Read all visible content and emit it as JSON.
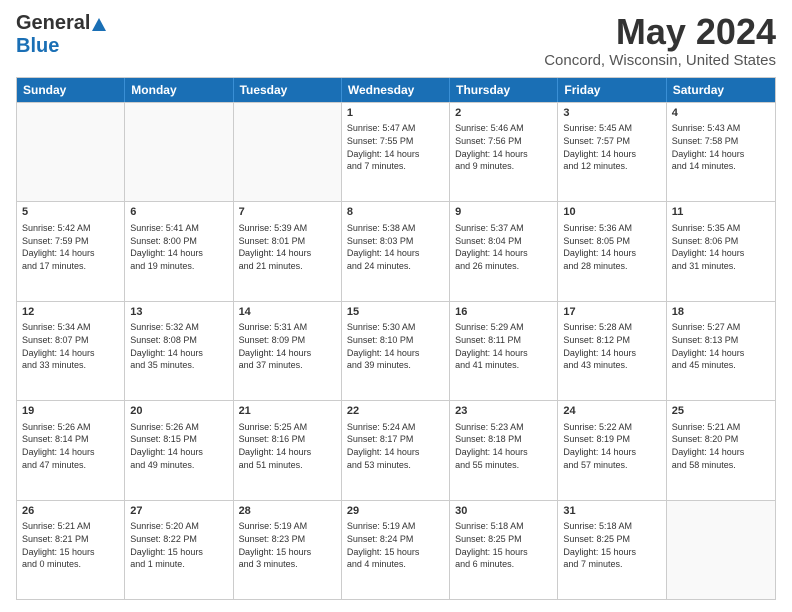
{
  "header": {
    "logo_general": "General",
    "logo_blue": "Blue",
    "month_title": "May 2024",
    "location": "Concord, Wisconsin, United States"
  },
  "days_of_week": [
    "Sunday",
    "Monday",
    "Tuesday",
    "Wednesday",
    "Thursday",
    "Friday",
    "Saturday"
  ],
  "weeks": [
    [
      {
        "day": "",
        "info": ""
      },
      {
        "day": "",
        "info": ""
      },
      {
        "day": "",
        "info": ""
      },
      {
        "day": "1",
        "info": "Sunrise: 5:47 AM\nSunset: 7:55 PM\nDaylight: 14 hours\nand 7 minutes."
      },
      {
        "day": "2",
        "info": "Sunrise: 5:46 AM\nSunset: 7:56 PM\nDaylight: 14 hours\nand 9 minutes."
      },
      {
        "day": "3",
        "info": "Sunrise: 5:45 AM\nSunset: 7:57 PM\nDaylight: 14 hours\nand 12 minutes."
      },
      {
        "day": "4",
        "info": "Sunrise: 5:43 AM\nSunset: 7:58 PM\nDaylight: 14 hours\nand 14 minutes."
      }
    ],
    [
      {
        "day": "5",
        "info": "Sunrise: 5:42 AM\nSunset: 7:59 PM\nDaylight: 14 hours\nand 17 minutes."
      },
      {
        "day": "6",
        "info": "Sunrise: 5:41 AM\nSunset: 8:00 PM\nDaylight: 14 hours\nand 19 minutes."
      },
      {
        "day": "7",
        "info": "Sunrise: 5:39 AM\nSunset: 8:01 PM\nDaylight: 14 hours\nand 21 minutes."
      },
      {
        "day": "8",
        "info": "Sunrise: 5:38 AM\nSunset: 8:03 PM\nDaylight: 14 hours\nand 24 minutes."
      },
      {
        "day": "9",
        "info": "Sunrise: 5:37 AM\nSunset: 8:04 PM\nDaylight: 14 hours\nand 26 minutes."
      },
      {
        "day": "10",
        "info": "Sunrise: 5:36 AM\nSunset: 8:05 PM\nDaylight: 14 hours\nand 28 minutes."
      },
      {
        "day": "11",
        "info": "Sunrise: 5:35 AM\nSunset: 8:06 PM\nDaylight: 14 hours\nand 31 minutes."
      }
    ],
    [
      {
        "day": "12",
        "info": "Sunrise: 5:34 AM\nSunset: 8:07 PM\nDaylight: 14 hours\nand 33 minutes."
      },
      {
        "day": "13",
        "info": "Sunrise: 5:32 AM\nSunset: 8:08 PM\nDaylight: 14 hours\nand 35 minutes."
      },
      {
        "day": "14",
        "info": "Sunrise: 5:31 AM\nSunset: 8:09 PM\nDaylight: 14 hours\nand 37 minutes."
      },
      {
        "day": "15",
        "info": "Sunrise: 5:30 AM\nSunset: 8:10 PM\nDaylight: 14 hours\nand 39 minutes."
      },
      {
        "day": "16",
        "info": "Sunrise: 5:29 AM\nSunset: 8:11 PM\nDaylight: 14 hours\nand 41 minutes."
      },
      {
        "day": "17",
        "info": "Sunrise: 5:28 AM\nSunset: 8:12 PM\nDaylight: 14 hours\nand 43 minutes."
      },
      {
        "day": "18",
        "info": "Sunrise: 5:27 AM\nSunset: 8:13 PM\nDaylight: 14 hours\nand 45 minutes."
      }
    ],
    [
      {
        "day": "19",
        "info": "Sunrise: 5:26 AM\nSunset: 8:14 PM\nDaylight: 14 hours\nand 47 minutes."
      },
      {
        "day": "20",
        "info": "Sunrise: 5:26 AM\nSunset: 8:15 PM\nDaylight: 14 hours\nand 49 minutes."
      },
      {
        "day": "21",
        "info": "Sunrise: 5:25 AM\nSunset: 8:16 PM\nDaylight: 14 hours\nand 51 minutes."
      },
      {
        "day": "22",
        "info": "Sunrise: 5:24 AM\nSunset: 8:17 PM\nDaylight: 14 hours\nand 53 minutes."
      },
      {
        "day": "23",
        "info": "Sunrise: 5:23 AM\nSunset: 8:18 PM\nDaylight: 14 hours\nand 55 minutes."
      },
      {
        "day": "24",
        "info": "Sunrise: 5:22 AM\nSunset: 8:19 PM\nDaylight: 14 hours\nand 57 minutes."
      },
      {
        "day": "25",
        "info": "Sunrise: 5:21 AM\nSunset: 8:20 PM\nDaylight: 14 hours\nand 58 minutes."
      }
    ],
    [
      {
        "day": "26",
        "info": "Sunrise: 5:21 AM\nSunset: 8:21 PM\nDaylight: 15 hours\nand 0 minutes."
      },
      {
        "day": "27",
        "info": "Sunrise: 5:20 AM\nSunset: 8:22 PM\nDaylight: 15 hours\nand 1 minute."
      },
      {
        "day": "28",
        "info": "Sunrise: 5:19 AM\nSunset: 8:23 PM\nDaylight: 15 hours\nand 3 minutes."
      },
      {
        "day": "29",
        "info": "Sunrise: 5:19 AM\nSunset: 8:24 PM\nDaylight: 15 hours\nand 4 minutes."
      },
      {
        "day": "30",
        "info": "Sunrise: 5:18 AM\nSunset: 8:25 PM\nDaylight: 15 hours\nand 6 minutes."
      },
      {
        "day": "31",
        "info": "Sunrise: 5:18 AM\nSunset: 8:25 PM\nDaylight: 15 hours\nand 7 minutes."
      },
      {
        "day": "",
        "info": ""
      }
    ]
  ]
}
